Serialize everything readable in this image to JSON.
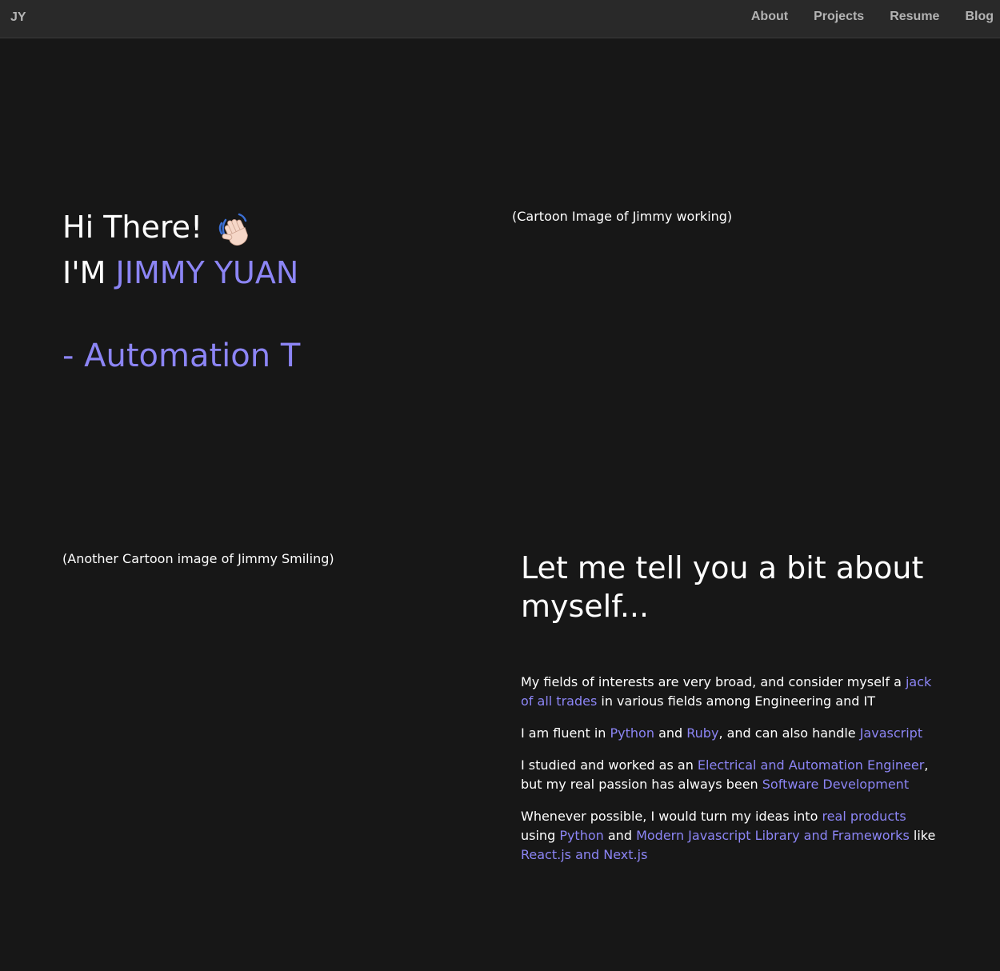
{
  "nav": {
    "brand": "JY",
    "links": [
      "About",
      "Projects",
      "Resume",
      "Blog"
    ]
  },
  "hero": {
    "greeting": "Hi There!",
    "name_prefix": "I'M",
    "name": "JIMMY YUAN",
    "typewriter": "- Automation T",
    "image_alt": "(Cartoon Image of Jimmy working)",
    "wave_icon": "waving-hand-icon"
  },
  "about": {
    "image_alt": "(Another Cartoon image of Jimmy Smiling)",
    "title": "Let me tell you a bit about myself...",
    "p1": {
      "a": "My fields of interests are very broad, and consider myself a ",
      "b": "jack of all trades",
      "c": " in various fields among Engineering and IT"
    },
    "p2": {
      "a": "I am fluent in ",
      "b": "Python",
      "c": " and ",
      "d": "Ruby",
      "e": ", and can also handle ",
      "f": "Javascript"
    },
    "p3": {
      "a": "I studied and worked as an ",
      "b": "Electrical and Automation Engineer",
      "c": ", but my real passion has always been ",
      "d": "Software Development"
    },
    "p4": {
      "a": "Whenever possible, I would turn my ideas into ",
      "b": "real products",
      "c": " using ",
      "d": "Python",
      "e": " and ",
      "f": "Modern Javascript Library and Frameworks",
      "g": " like ",
      "h": "React.js and Next.js"
    }
  },
  "colors": {
    "background": "#171717",
    "navbar": "#292929",
    "accent": "#8c85f5",
    "nav_text": "#b3b3b3"
  }
}
